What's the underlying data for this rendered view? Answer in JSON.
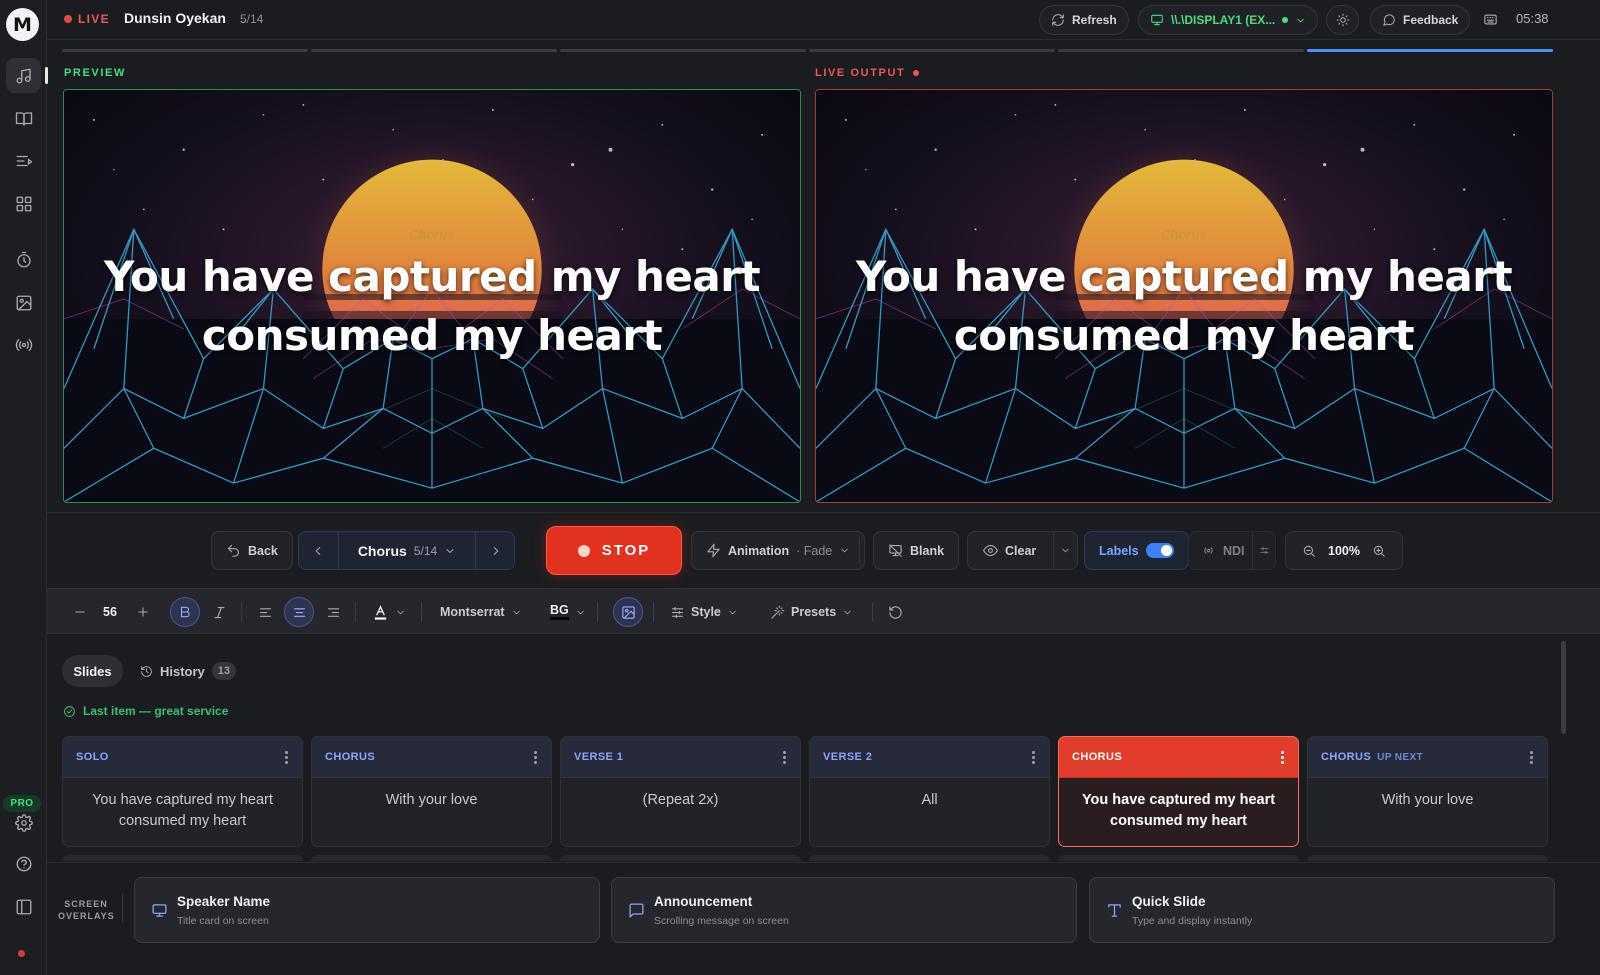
{
  "app": {
    "logo_letter": "M"
  },
  "topbar": {
    "live_label": "LIVE",
    "song_title": "Dunsin Oyekan",
    "song_position": "5/14",
    "refresh_label": "Refresh",
    "display_label": "\\\\.\\DISPLAY1 (EX...",
    "feedback_label": "Feedback",
    "clock": "05:38"
  },
  "progress": {
    "segments": 6,
    "active_segment": 6
  },
  "preview": {
    "label": "PREVIEW",
    "section": "Chorus",
    "lyric": "You have captured my heart consumed my heart"
  },
  "output": {
    "label": "LIVE OUTPUT",
    "section": "Chorus",
    "lyric": "You have captured my heart consumed my heart"
  },
  "controls": {
    "back_label": "Back",
    "current_section": "Chorus",
    "current_position": "5/14",
    "stop_label": "STOP",
    "animation_label": "Animation",
    "animation_value": "· Fade",
    "blank_label": "Blank",
    "clear_label": "Clear",
    "labels_label": "Labels",
    "labels_on": true,
    "ndi_label": "NDI",
    "zoom_value": "100%"
  },
  "format": {
    "font_size": "56",
    "font_family": "Montserrat",
    "bg_label": "BG",
    "style_label": "Style",
    "presets_label": "Presets"
  },
  "slides_panel": {
    "tab_slides": "Slides",
    "tab_history": "History",
    "history_count": "13",
    "status": "Last item — great service",
    "cards": [
      {
        "label": "SOLO",
        "text": "You have captured my heart consumed my heart",
        "live": false,
        "up_next": ""
      },
      {
        "label": "CHORUS",
        "text": "With your love",
        "live": false,
        "up_next": ""
      },
      {
        "label": "VERSE 1",
        "text": "(Repeat 2x)",
        "live": false,
        "up_next": ""
      },
      {
        "label": "VERSE 2",
        "text": "All",
        "live": false,
        "up_next": ""
      },
      {
        "label": "CHORUS",
        "text": "You have captured my heart consumed my heart",
        "live": true,
        "up_next": ""
      },
      {
        "label": "CHORUS",
        "text": "With your love",
        "live": false,
        "up_next": "UP NEXT"
      }
    ]
  },
  "overlays": {
    "section_label": "SCREEN OVERLAYS",
    "items": [
      {
        "title": "Speaker Name",
        "subtitle": "Title card on screen",
        "icon": "monitor-icon"
      },
      {
        "title": "Announcement",
        "subtitle": "Scrolling message on screen",
        "icon": "message-icon"
      },
      {
        "title": "Quick Slide",
        "subtitle": "Type and display instantly",
        "icon": "text-icon"
      }
    ]
  },
  "sidebar": {
    "pro_label": "PRO"
  },
  "colors": {
    "live_red": "#e23c2c",
    "preview_green": "#4ade80",
    "accent_blue": "#4f8ff7"
  }
}
